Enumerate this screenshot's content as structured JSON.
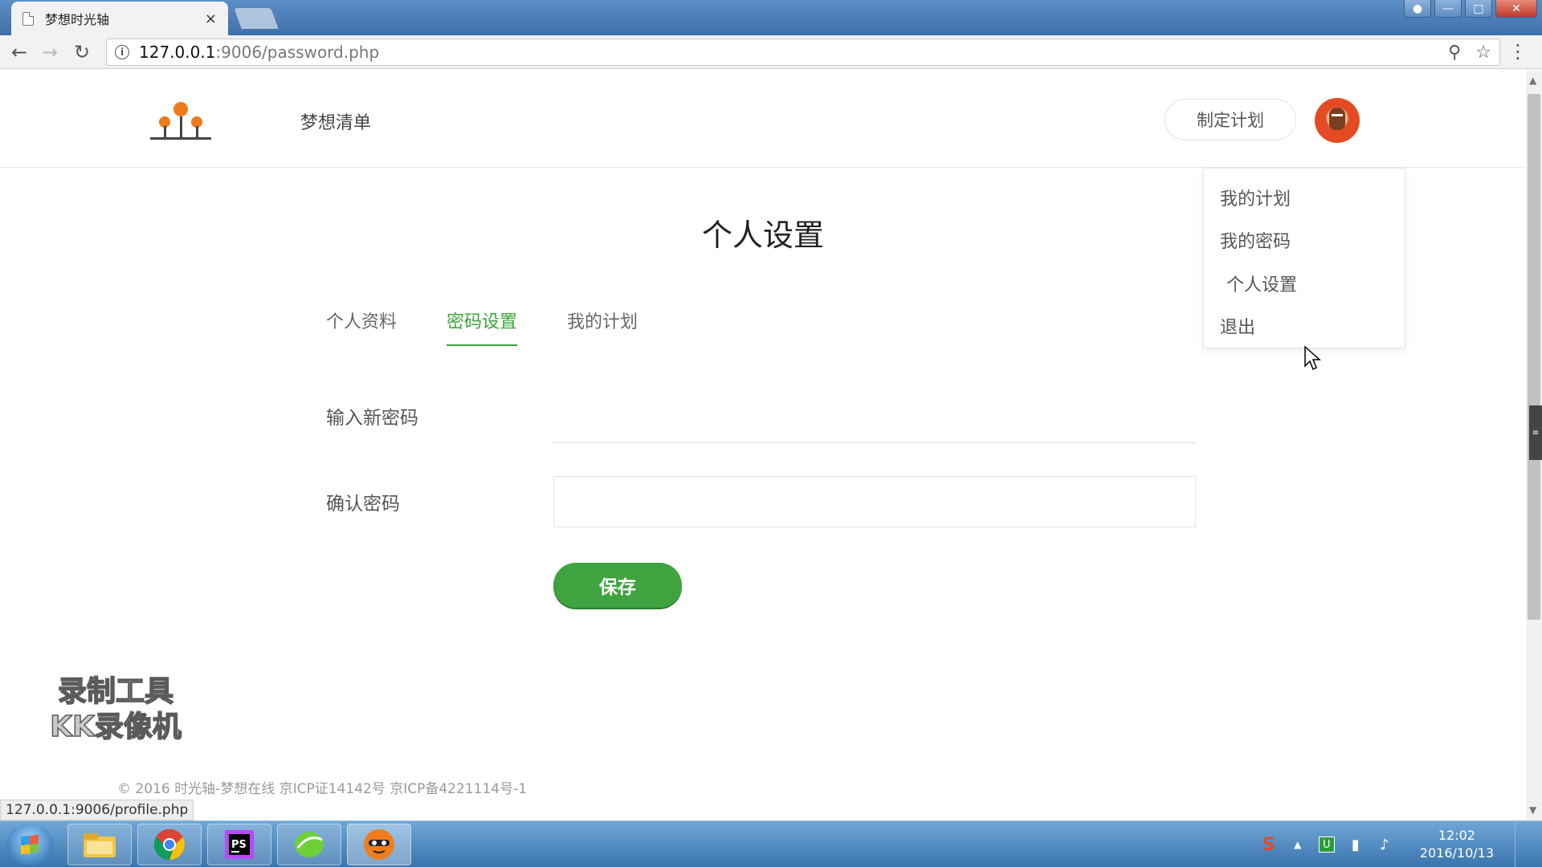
{
  "browser": {
    "tab_title": "梦想时光轴",
    "tab_close": "×",
    "url_host": "127.0.0.1",
    "url_rest": ":9006/password.php",
    "status_link": "127.0.0.1:9006/profile.php"
  },
  "header": {
    "nav_link": "梦想清单",
    "plan_button": "制定计划"
  },
  "dropdown": {
    "items": [
      "我的计划",
      "我的密码",
      "个人设置",
      "退出"
    ]
  },
  "page": {
    "title": "个人设置",
    "tabs": [
      {
        "label": "个人资料",
        "active": false
      },
      {
        "label": "密码设置",
        "active": true
      },
      {
        "label": "我的计划",
        "active": false
      }
    ],
    "fields": [
      {
        "label": "输入新密码",
        "value": ""
      },
      {
        "label": "确认密码",
        "value": ""
      }
    ],
    "save_button": "保存"
  },
  "watermark": {
    "line1": "录制工具",
    "line2": "KK录像机"
  },
  "footer": {
    "text": "© 2016 时光轴-梦想在线   京ICP证14142号   京ICP备4221114号-1"
  },
  "taskbar": {
    "time": "12:02",
    "date": "2016/10/13"
  },
  "colors": {
    "accent_green": "#3fa33f",
    "avatar_red": "#e44b24",
    "logo_orange": "#ef7a1a"
  }
}
